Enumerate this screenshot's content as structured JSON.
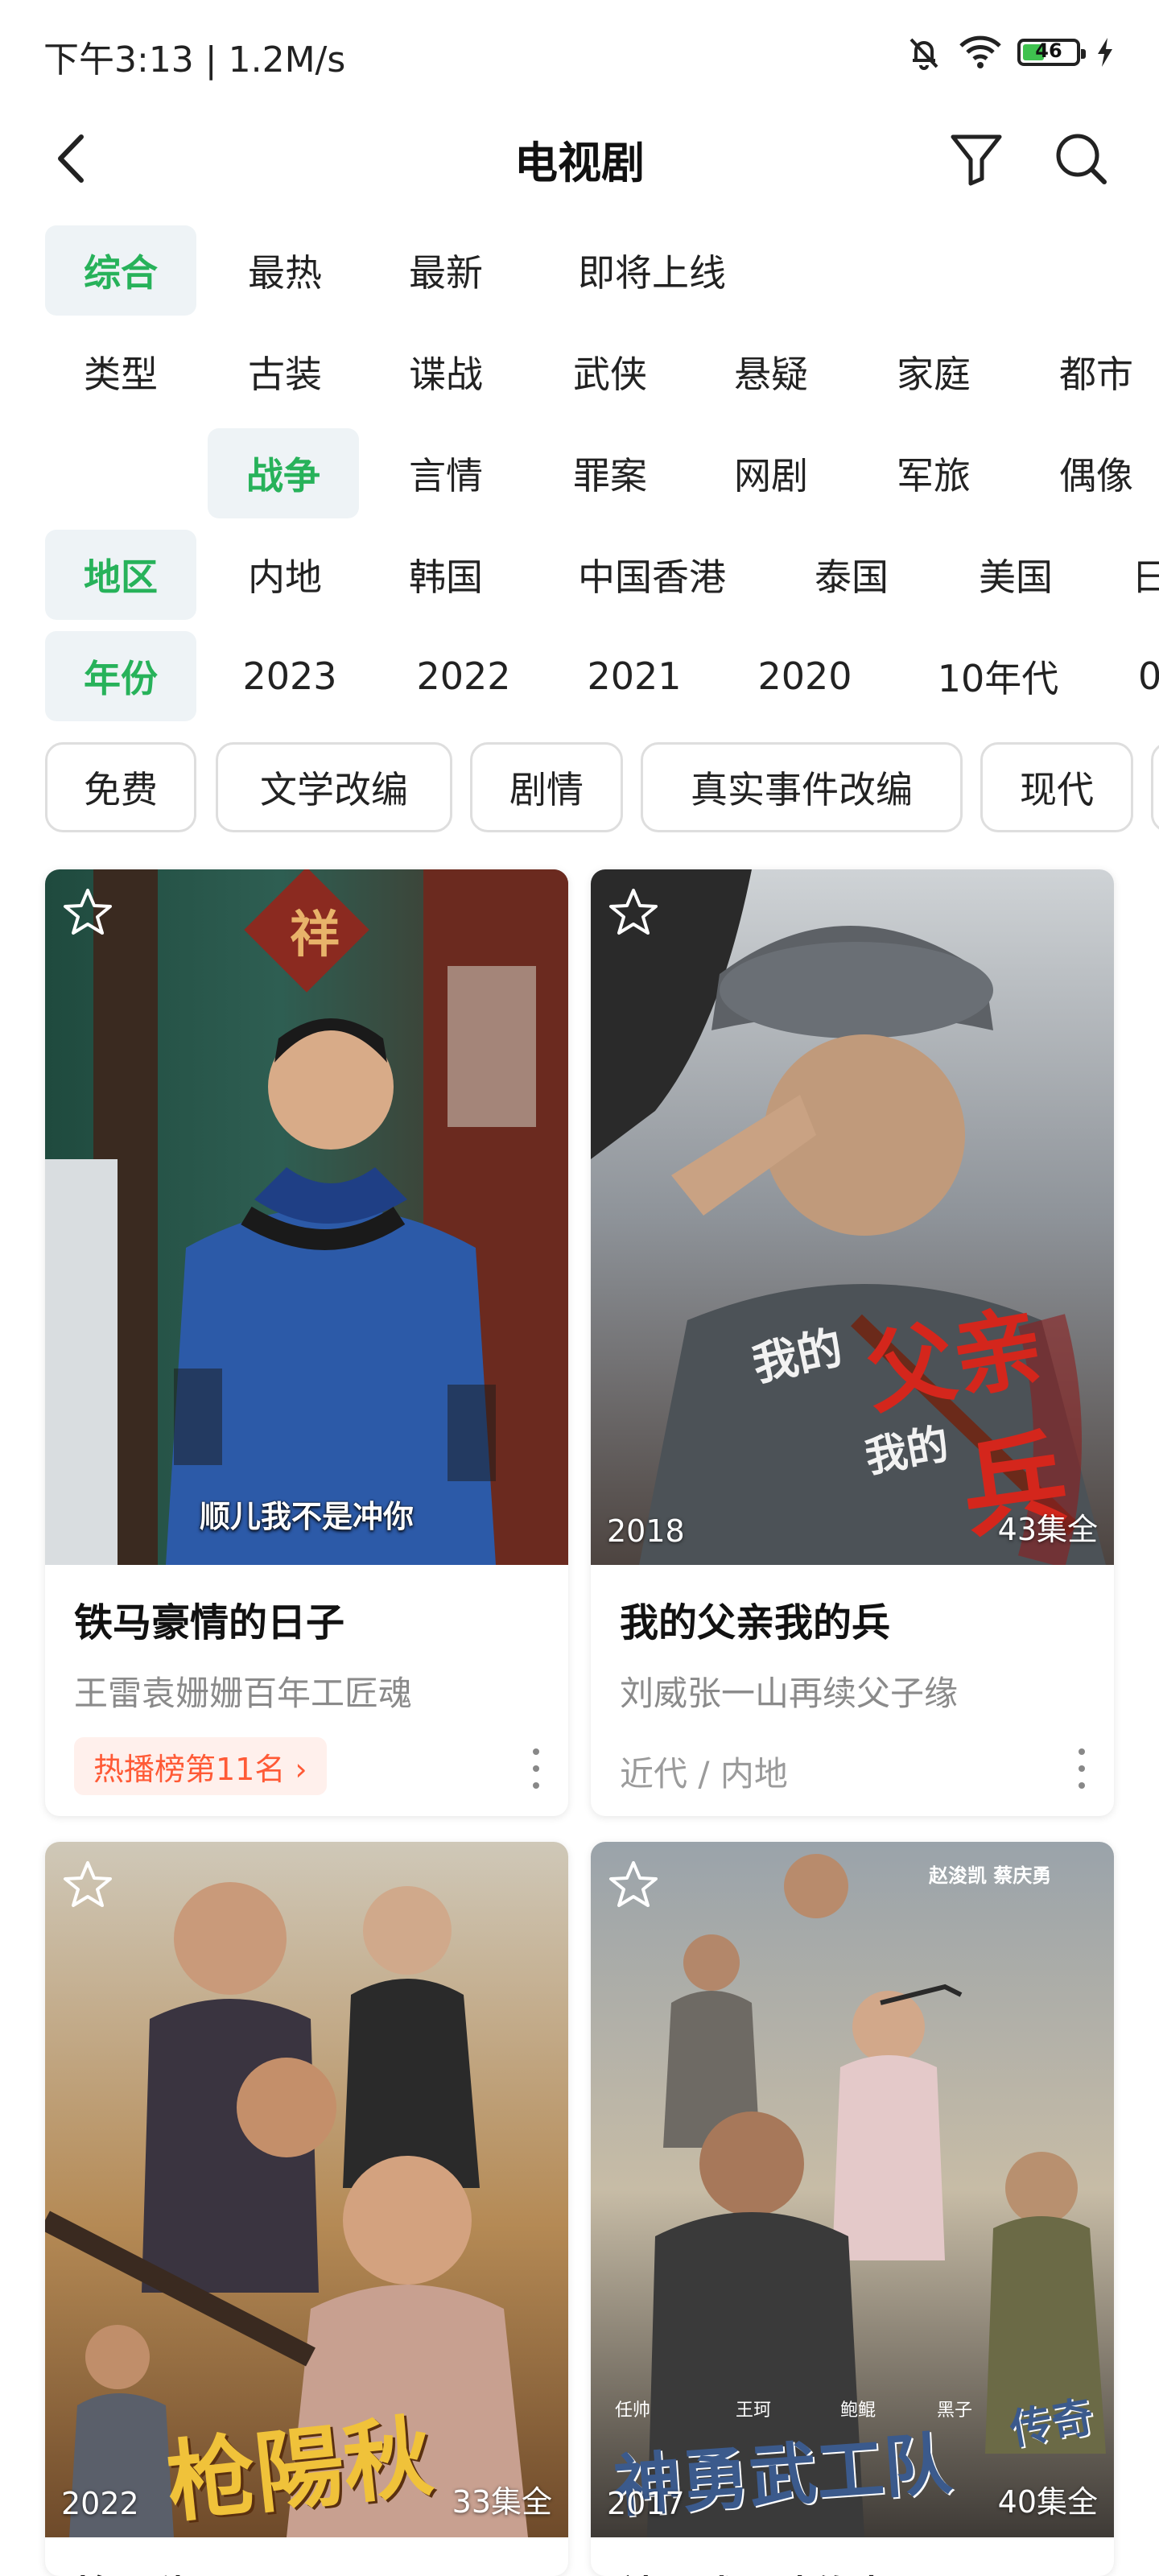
{
  "status": {
    "time": "下午3:13 | 1.2M/s",
    "battery": "46",
    "battery_level": 0.46
  },
  "nav": {
    "title": "电视剧",
    "back_icon": "back-arrow-icon",
    "filter_icon": "filter-icon",
    "search_icon": "search-icon"
  },
  "filters": {
    "sort": {
      "options": [
        "综合",
        "最热",
        "最新",
        "即将上线"
      ],
      "selected": "综合"
    },
    "type": {
      "label": "类型",
      "row1": [
        "古装",
        "谍战",
        "武侠",
        "悬疑",
        "家庭",
        "都市"
      ],
      "row2": [
        "战争",
        "言情",
        "罪案",
        "网剧",
        "军旅",
        "偶像"
      ],
      "selected": "战争"
    },
    "region": {
      "label": "地区",
      "options": [
        "内地",
        "韩国",
        "中国香港",
        "泰国",
        "美国",
        "日"
      ]
    },
    "year": {
      "label": "年份",
      "options": [
        "2023",
        "2022",
        "2021",
        "2020",
        "10年代",
        "0"
      ]
    }
  },
  "tags": [
    "免费",
    "文学改编",
    "剧情",
    "真实事件改编",
    "现代"
  ],
  "cards": [
    {
      "title": "铁马豪情的日子",
      "subtitle": "王雷袁姗姗百年工匠魂",
      "rank": "热播榜第11名 ›",
      "caption": "顺儿我不是冲你",
      "sign": "祥"
    },
    {
      "title": "我的父亲我的兵",
      "subtitle": "刘威张一山再续父子缘",
      "meta": "近代 / 内地",
      "year": "2018",
      "episodes": "43集全",
      "art_a": "我的",
      "art_b": "父亲",
      "art_c": "我的",
      "art_d": "兵"
    },
    {
      "title": "枪阳秋",
      "year": "2022",
      "episodes": "33集全",
      "art": "枪陽秋"
    },
    {
      "title": "神勇武工队传奇",
      "year": "2017",
      "episodes": "40集全",
      "art": "神勇武工队",
      "art_small": "传奇",
      "cast": [
        "任帅",
        "王珂",
        "鲍鲲",
        "黑子"
      ],
      "cast_top": "赵浚凯 蔡庆勇"
    }
  ],
  "colors": {
    "accent": "#27b25a",
    "rank": "#ff5a36"
  }
}
